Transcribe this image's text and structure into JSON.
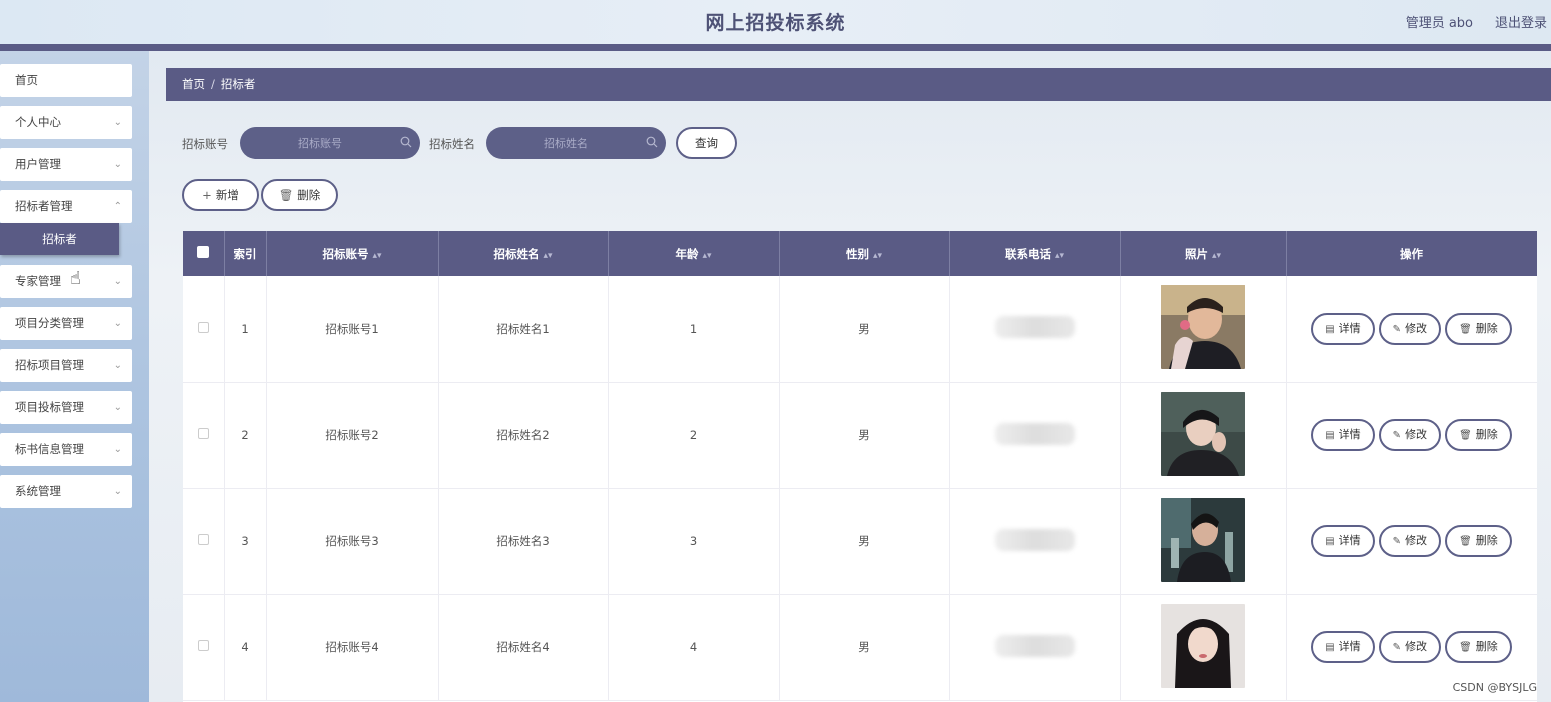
{
  "header": {
    "title": "网上招投标系统",
    "user": "管理员 abo",
    "logout": "退出登录"
  },
  "sidebar": {
    "items": [
      {
        "label": "首页",
        "has_children": false
      },
      {
        "label": "个人中心",
        "has_children": true
      },
      {
        "label": "用户管理",
        "has_children": true
      },
      {
        "label": "招标者管理",
        "has_children": true
      },
      {
        "label": "专家管理",
        "has_children": true
      },
      {
        "label": "项目分类管理",
        "has_children": true
      },
      {
        "label": "招标项目管理",
        "has_children": true
      },
      {
        "label": "项目投标管理",
        "has_children": true
      },
      {
        "label": "标书信息管理",
        "has_children": true
      },
      {
        "label": "系统管理",
        "has_children": true
      }
    ],
    "active_submenu": "招标者"
  },
  "breadcrumb": {
    "home": "首页",
    "separator": "/",
    "current": "招标者"
  },
  "search": {
    "account_label": "招标账号",
    "account_placeholder": "招标账号",
    "name_label": "招标姓名",
    "name_placeholder": "招标姓名",
    "query_button": "查询"
  },
  "toolbar": {
    "add_label": "新增",
    "delete_label": "删除"
  },
  "table": {
    "columns": [
      "索引",
      "招标账号",
      "招标姓名",
      "年龄",
      "性别",
      "联系电话",
      "照片",
      "操作"
    ],
    "rows": [
      {
        "index": "1",
        "account": "招标账号1",
        "name": "招标姓名1",
        "age": "1",
        "gender": "男"
      },
      {
        "index": "2",
        "account": "招标账号2",
        "name": "招标姓名2",
        "age": "2",
        "gender": "男"
      },
      {
        "index": "3",
        "account": "招标账号3",
        "name": "招标姓名3",
        "age": "3",
        "gender": "男"
      },
      {
        "index": "4",
        "account": "招标账号4",
        "name": "招标姓名4",
        "age": "4",
        "gender": "男"
      }
    ],
    "row_actions": {
      "detail": "详情",
      "edit": "修改",
      "delete": "删除"
    }
  },
  "watermark": "CSDN @BYSJLG",
  "colors": {
    "primary": "#5a5b85",
    "sidebar_bg": "#aac2df"
  }
}
